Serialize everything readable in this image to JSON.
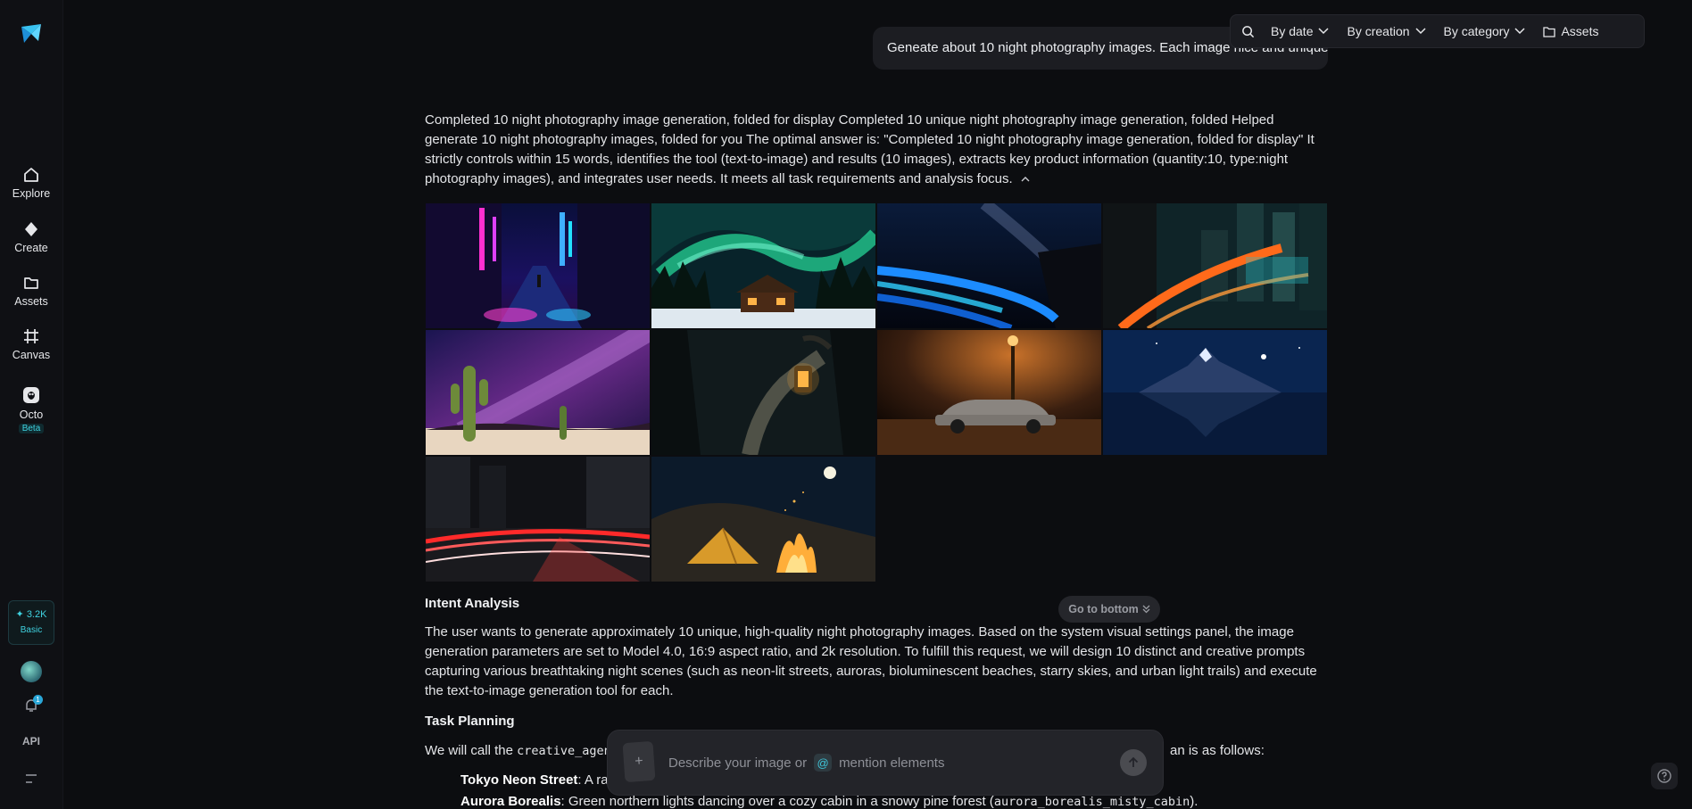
{
  "sidebar": {
    "items": [
      {
        "label": "Explore",
        "icon": "home-icon"
      },
      {
        "label": "Create",
        "icon": "diamond-icon"
      },
      {
        "label": "Assets",
        "icon": "folder-icon"
      },
      {
        "label": "Canvas",
        "icon": "frame-icon"
      },
      {
        "label": "Octo",
        "icon": "octo-icon",
        "badge": "Beta"
      }
    ],
    "credits": {
      "amount": "3.2K",
      "tier": "Basic"
    },
    "notification_count": "1",
    "api_label": "API"
  },
  "toolbar": {
    "by_date": "By date",
    "by_creation": "By creation",
    "by_category": "By category",
    "assets": "Assets"
  },
  "user_prompt": "Geneate about 10 night photography images. Each image nice and unique.",
  "summary": "Completed 10 night photography image generation, folded for display Completed 10 unique night photography image generation, folded Helped generate 10 night photography images, folded for you The optimal answer is: \"Completed 10 night photography image generation, folded for display\" It strictly controls within 15 words, identifies the tool (text-to-image) and results (10 images), extracts key product information (quantity:10, type:night photography images), and integrates user needs. It meets all task requirements and analysis focus.",
  "images": [
    "neon-street",
    "aurora-cabin",
    "bioluminescent-beach",
    "cyberpunk-city",
    "desert-milky-way",
    "forest-lantern",
    "vintage-car-streetlamp",
    "mountain-lake-stars",
    "city-light-trails",
    "campfire-tent"
  ],
  "intent": {
    "title": "Intent Analysis",
    "text": "The user wants to generate approximately 10 unique, high-quality night photography images. Based on the system visual settings panel, the image generation parameters are set to Model 4.0, 16:9 aspect ratio, and 2k resolution. To fulfill this request, we will design 10 distinct and creative prompts capturing various breathtaking night scenes (such as neon-lit streets, auroras, bioluminescent beaches, starry skies, and urban light trails) and execute the text-to-image generation tool for each."
  },
  "planning": {
    "title": "Task Planning",
    "intro_start": "We will call the ",
    "intro_code": "creative_agent",
    "intro_end": "an is as follows:",
    "items": [
      {
        "name": "Tokyo Neon Street",
        "text": ": A rai"
      },
      {
        "name": "Aurora Borealis",
        "text": ": Green northern lights dancing over a cozy cabin in a snowy pine forest (",
        "code": "aurora_borealis_misty_cabin",
        "end": ")."
      }
    ]
  },
  "goto_bottom": "Go to bottom",
  "composer": {
    "placeholder_start": "Describe your image or",
    "at": "@",
    "placeholder_end": "mention elements",
    "add": "+"
  },
  "colors": {
    "accent": "#3fd2e0",
    "background": "#0c0d10",
    "panel": "#1a1b20"
  }
}
